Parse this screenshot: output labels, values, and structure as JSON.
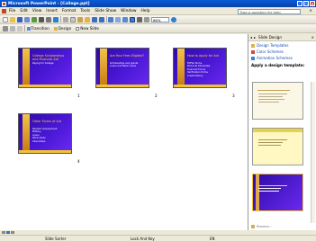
{
  "window": {
    "title": "Microsoft PowerPoint - [College.ppt]",
    "controls": [
      "_",
      "□",
      "×"
    ]
  },
  "menu": {
    "items": [
      "File",
      "Edit",
      "View",
      "Insert",
      "Format",
      "Tools",
      "Slide Show",
      "Window",
      "Help"
    ],
    "help_placeholder": "Type a question for help",
    "close": "×"
  },
  "toolbar": {
    "zoom": "66%",
    "transition_label": "Transition",
    "design_label": "Design",
    "new_slide_label": "New Slide"
  },
  "slides": [
    {
      "number": "1",
      "title": "College Scholarships and Financial Aid",
      "body": [
        "Paying for College"
      ]
    },
    {
      "number": "2",
      "title": "Are Your Fees Eligible?",
      "body": [
        "Scholarships and grants",
        "Loans and Bank Loans"
      ]
    },
    {
      "number": "3",
      "title": "How to Apply for Aid",
      "body": [
        "FAFSA forms",
        "Personal Interviews",
        "Financial Forms",
        "Verification forms",
        "Credit history"
      ]
    },
    {
      "number": "4",
      "title": "Other Forms of Aid",
      "body": [
        "Student employment",
        "Military",
        "Loans",
        "Work-study",
        "Internships"
      ]
    }
  ],
  "panel": {
    "title": "Slide Design",
    "links": [
      "Design Templates",
      "Color Schemes",
      "Animation Schemes"
    ],
    "section_label": "Apply a design template:",
    "browse": "Browse..."
  },
  "status": {
    "view": "Slide Sorter",
    "template": "Lock And Key",
    "language": "EN"
  },
  "colors": {
    "title_bar": "#0a5ad8",
    "slide_bg": "#4a17d6",
    "accent": "#f2c236",
    "link": "#1648b6"
  }
}
